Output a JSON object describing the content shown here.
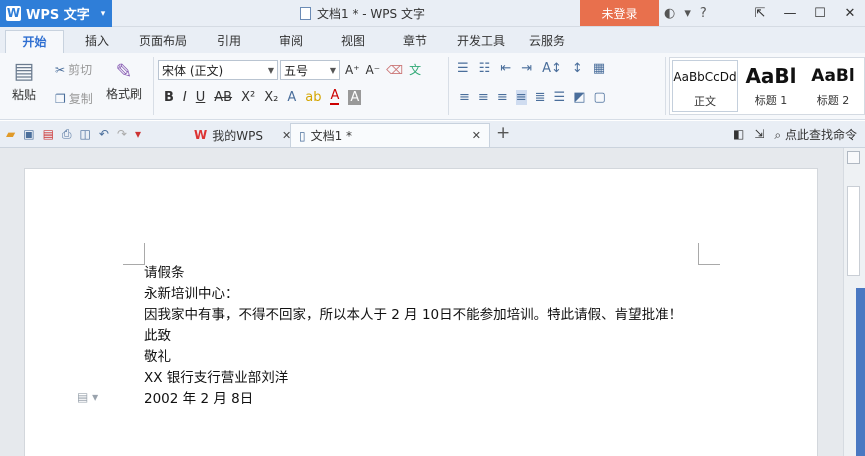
{
  "titlebar": {
    "app_name": "WPS 文字",
    "doc_title": "文档1 * - WPS 文字",
    "login_label": "未登录"
  },
  "menu": {
    "tabs": [
      "开始",
      "插入",
      "页面布局",
      "引用",
      "审阅",
      "视图",
      "章节",
      "开发工具",
      "云服务"
    ]
  },
  "ribbon": {
    "paste_label": "粘贴",
    "cut_label": "剪切",
    "copy_label": "复制",
    "format_painter_label": "格式刷",
    "font_name": "宋体 (正文)",
    "font_size": "五号",
    "styles": [
      {
        "preview": "AaBbCcDd",
        "name": "正文"
      },
      {
        "preview": "AaBl",
        "name": "标题 1"
      },
      {
        "preview": "AaBl",
        "name": "标题 2"
      }
    ]
  },
  "tabs": {
    "home_tab": "我的WPS",
    "doc_tab": "文档1 *",
    "search_label": "点此查找命令"
  },
  "document": {
    "lines": [
      "请假条",
      "永新培训中心：",
      "因我家中有事，不得不回家，所以本人于 2 月 10日不能参加培训。特此请假、肯望批准！",
      "此致",
      "敬礼",
      "XX 银行支行营业部刘洋",
      "2002 年 2 月 8日"
    ]
  },
  "colors": {
    "accent": "#2f7ed8",
    "login": "#e8704d",
    "scroll_marker": "#4a78c2"
  }
}
